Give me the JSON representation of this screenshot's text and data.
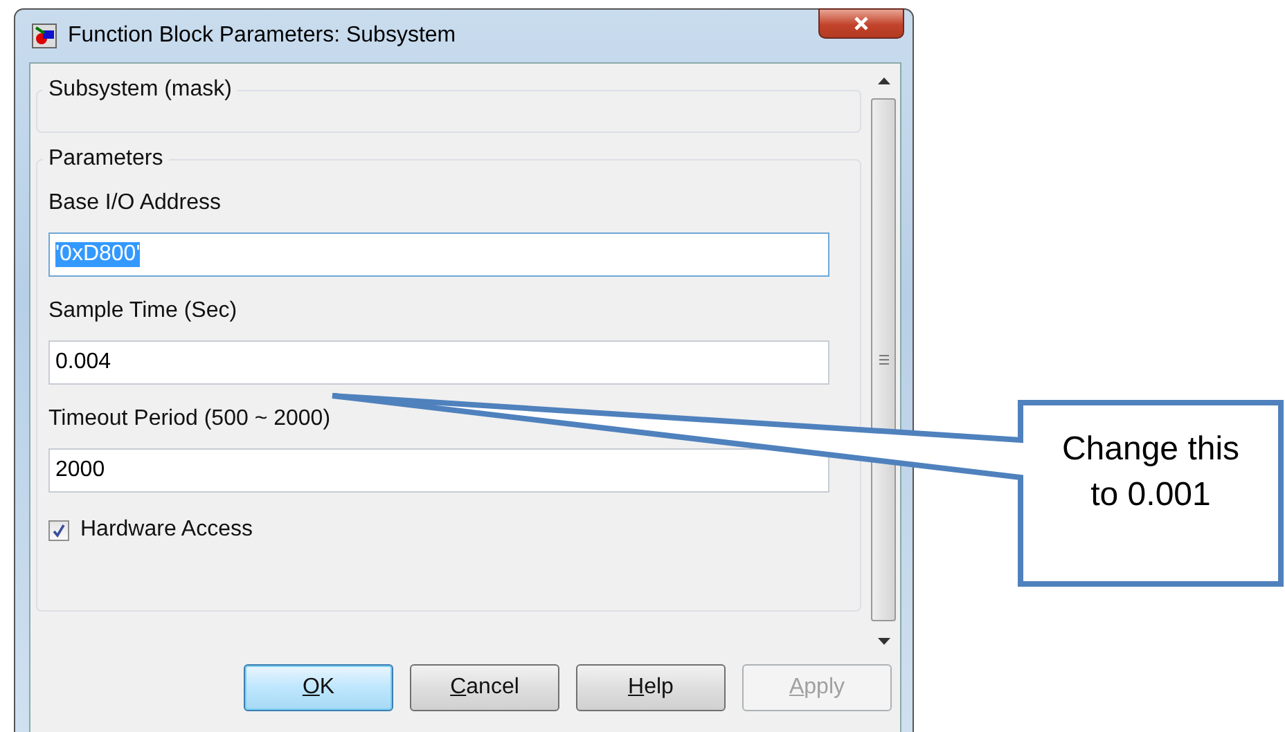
{
  "window": {
    "title": "Function Block Parameters: Subsystem"
  },
  "mask_group": {
    "title": "Subsystem (mask)"
  },
  "parameters_group": {
    "title": "Parameters",
    "fields": [
      {
        "label": "Base I/O Address",
        "value": "'0xD800'",
        "highlighted": true
      },
      {
        "label": "Sample Time (Sec)",
        "value": "0.004",
        "highlighted": false
      },
      {
        "label": "Timeout Period (500 ~ 2000)",
        "value": "2000",
        "highlighted": false
      }
    ],
    "checkbox": {
      "label": "Hardware Access",
      "checked": true
    }
  },
  "buttons": [
    {
      "label": "OK",
      "default": true,
      "disabled": false
    },
    {
      "label": "Cancel",
      "default": false,
      "disabled": false
    },
    {
      "label": "Help",
      "default": false,
      "disabled": false
    },
    {
      "label": "Apply",
      "default": false,
      "disabled": true
    }
  ],
  "callout": {
    "text": "Change this to 0.001"
  }
}
